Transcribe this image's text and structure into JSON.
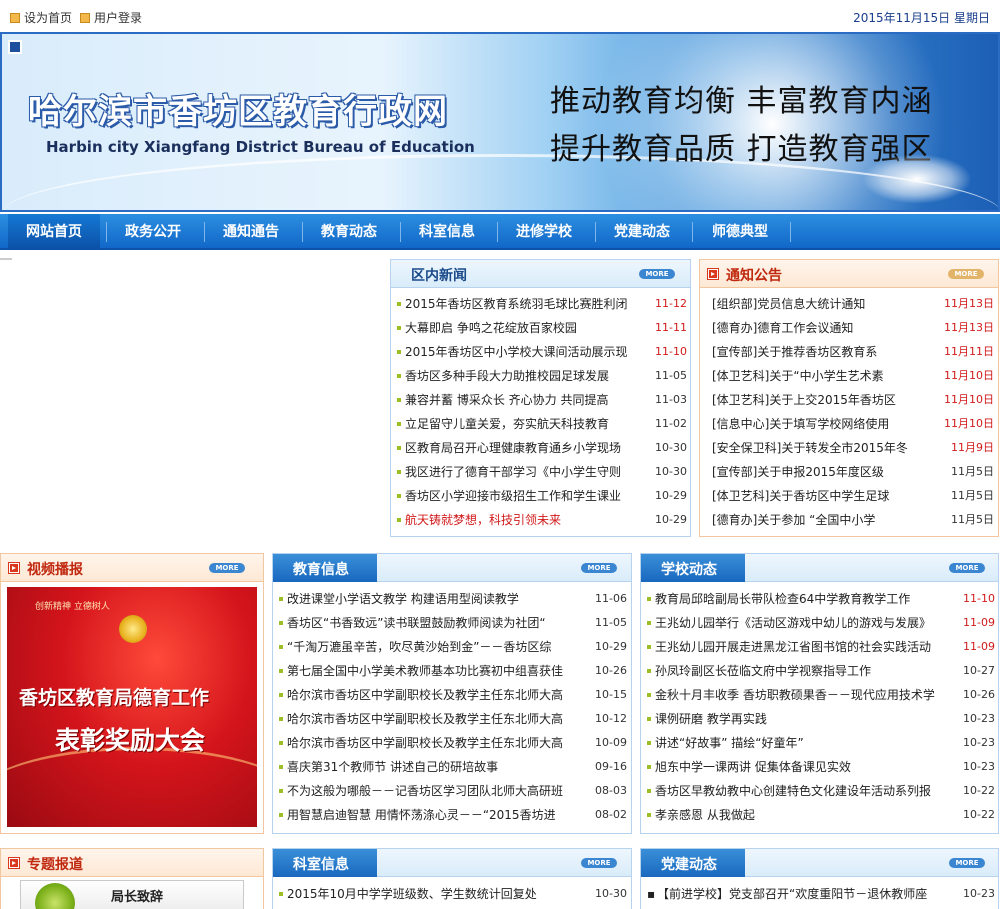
{
  "topbar": {
    "home_link": "设为首页",
    "login_link": "用户登录",
    "date": "2015年11月15日  星期日"
  },
  "banner": {
    "title_cn": "哈尔滨市香坊区教育行政网",
    "title_en": "Harbin city Xiangfang District Bureau of Education",
    "slogan_1": "推动教育均衡   丰富教育内涵",
    "slogan_2": "提升教育品质   打造教育强区"
  },
  "nav": {
    "items": [
      "网站首页",
      "政务公开",
      "通知通告",
      "教育动态",
      "科室信息",
      "进修学校",
      "党建动态",
      "师德典型"
    ]
  },
  "more_label": "MORE",
  "news": {
    "title": "区内新闻",
    "items": [
      {
        "text": "2015年香坊区教育系统羽毛球比赛胜利闭",
        "date": "11-12"
      },
      {
        "text": "大幕即启  争鸣之花绽放百家校园",
        "date": "11-11"
      },
      {
        "text": "2015年香坊区中小学校大课间活动展示现",
        "date": "11-10"
      },
      {
        "text": "香坊区多种手段大力助推校园足球发展",
        "date": "11-05"
      },
      {
        "text": "兼容并蓄 博采众长 齐心协力 共同提高",
        "date": "11-03"
      },
      {
        "text": "立足留守儿童关爱，夯实航天科技教育",
        "date": "11-02"
      },
      {
        "text": "区教育局召开心理健康教育通乡小学现场",
        "date": "10-30"
      },
      {
        "text": "我区进行了德育干部学习《中小学生守则",
        "date": "10-30"
      },
      {
        "text": "香坊区小学迎接市级招生工作和学生课业",
        "date": "10-29"
      },
      {
        "text": "航天铸就梦想，科技引领未来",
        "date": "10-29"
      }
    ]
  },
  "notice": {
    "title": "通知公告",
    "items": [
      {
        "text": "[组织部]党员信息大统计通知",
        "date": "11月13日"
      },
      {
        "text": "[德育办]德育工作会议通知",
        "date": "11月13日"
      },
      {
        "text": "[宣传部]关于推荐香坊区教育系",
        "date": "11月11日"
      },
      {
        "text": "[体卫艺科]关于“中小学生艺术素",
        "date": "11月10日"
      },
      {
        "text": "[体卫艺科]关于上交2015年香坊区",
        "date": "11月10日"
      },
      {
        "text": "[信息中心]关于填写学校网络使用",
        "date": "11月10日"
      },
      {
        "text": "[安全保卫科]关于转发全市2015年冬",
        "date": "11月9日"
      },
      {
        "text": "[宣传部]关于申报2015年度区级",
        "date": "11月5日"
      },
      {
        "text": "[体卫艺科]关于香坊区中学生足球",
        "date": "11月5日"
      },
      {
        "text": "[德育办]关于参加 “全国中小学",
        "date": "11月5日"
      }
    ]
  },
  "video": {
    "title": "视频播报",
    "top_text": "创新精神  立德树人",
    "line1": "香坊区教育局德育工作",
    "line2": "表彰奖励大会"
  },
  "edu_info": {
    "title": "教育信息",
    "items": [
      {
        "text": "改进课堂小学语文教学    构建语用型阅读教学",
        "date": "11-06"
      },
      {
        "text": "香坊区“书香致远”读书联盟鼓励教师阅读为社团“",
        "date": "11-05"
      },
      {
        "text": "“千淘万漉虽辛苦，吹尽黄沙始到金”－－香坊区综",
        "date": "10-29"
      },
      {
        "text": "第七届全国中小学美术教师基本功比赛初中组喜获佳",
        "date": "10-26"
      },
      {
        "text": "哈尔滨市香坊区中学副职校长及教学主任东北师大高",
        "date": "10-15"
      },
      {
        "text": "哈尔滨市香坊区中学副职校长及教学主任东北师大高",
        "date": "10-12"
      },
      {
        "text": "哈尔滨市香坊区中学副职校长及教学主任东北师大高",
        "date": "10-09"
      },
      {
        "text": "喜庆第31个教师节  讲述自己的研培故事",
        "date": "09-16"
      },
      {
        "text": "不为这般为哪般－－记香坊区学习团队北师大高研班",
        "date": "08-03"
      },
      {
        "text": "用智慧启迪智慧  用情怀荡涤心灵－－“2015香坊进",
        "date": "08-02"
      }
    ]
  },
  "school_news": {
    "title": "学校动态",
    "items": [
      {
        "text": "教育局邱晗副局长带队检查64中学教育教学工作",
        "date": "11-10"
      },
      {
        "text": "王兆幼儿园举行《活动区游戏中幼儿的游戏与发展》",
        "date": "11-09"
      },
      {
        "text": "王兆幼儿园开展走进黑龙江省图书馆的社会实践活动",
        "date": "11-09"
      },
      {
        "text": "孙凤玲副区长莅临文府中学视察指导工作",
        "date": "10-27"
      },
      {
        "text": "金秋十月丰收季 香坊职教硕果香－－现代应用技术学",
        "date": "10-26"
      },
      {
        "text": "课例研磨    教学再实践",
        "date": "10-23"
      },
      {
        "text": "讲述“好故事”    描绘“好童年”",
        "date": "10-23"
      },
      {
        "text": "旭东中学一课两讲 促集体备课见实效",
        "date": "10-23"
      },
      {
        "text": "香坊区早教幼教中心创建特色文化建设年活动系列报",
        "date": "10-22"
      },
      {
        "text": "孝亲感恩   从我做起",
        "date": "10-22"
      }
    ]
  },
  "special": {
    "title": "专题报道",
    "item": "局长致辞"
  },
  "office_info": {
    "title": "科室信息",
    "items": [
      {
        "text": "2015年10月中学学班级数、学生数统计回复处",
        "date": "10-30"
      }
    ]
  },
  "party_news": {
    "title": "党建动态",
    "items": [
      {
        "text": "【前进学校】党支部召开“欢度重阳节－退休教师座",
        "date": "10-23"
      }
    ]
  },
  "colors": {
    "nav_blue": "#1a78d4",
    "date_red": "#d21a1a",
    "title_orange": "#c0280f",
    "bullet_green": "#9cbf26"
  }
}
